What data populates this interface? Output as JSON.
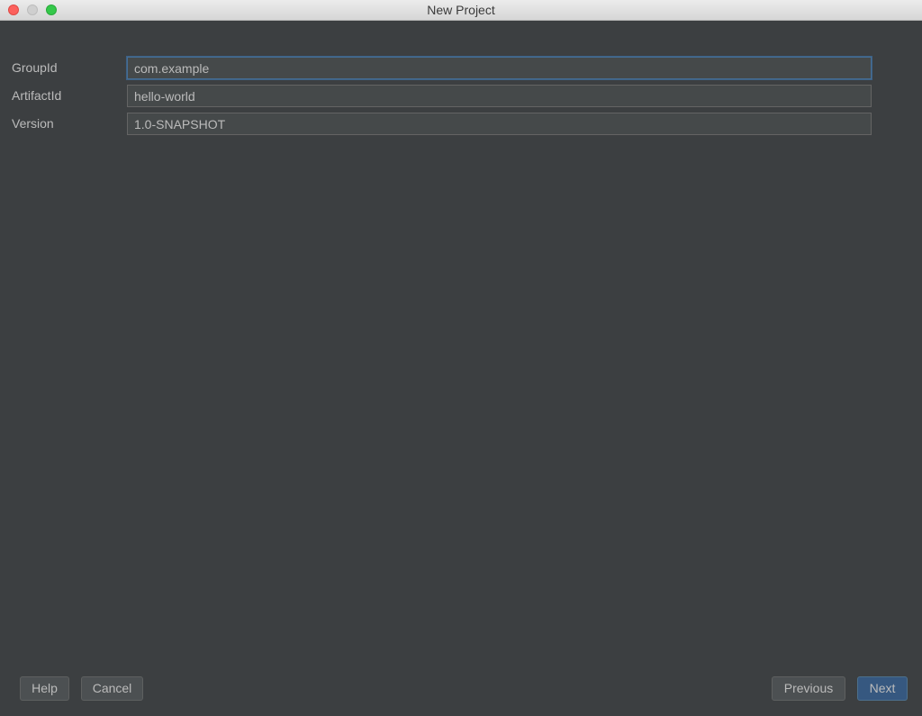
{
  "window": {
    "title": "New Project"
  },
  "form": {
    "group_id": {
      "label": "GroupId",
      "value": "com.example"
    },
    "artifact_id": {
      "label": "ArtifactId",
      "value": "hello-world"
    },
    "version": {
      "label": "Version",
      "value": "1.0-SNAPSHOT"
    }
  },
  "buttons": {
    "help": "Help",
    "cancel": "Cancel",
    "previous": "Previous",
    "next": "Next"
  },
  "colors": {
    "background": "#3c3f41",
    "input_background": "#45494a",
    "focus_border": "#466d94",
    "default_button": "#365880",
    "text": "#bbbbbb"
  }
}
